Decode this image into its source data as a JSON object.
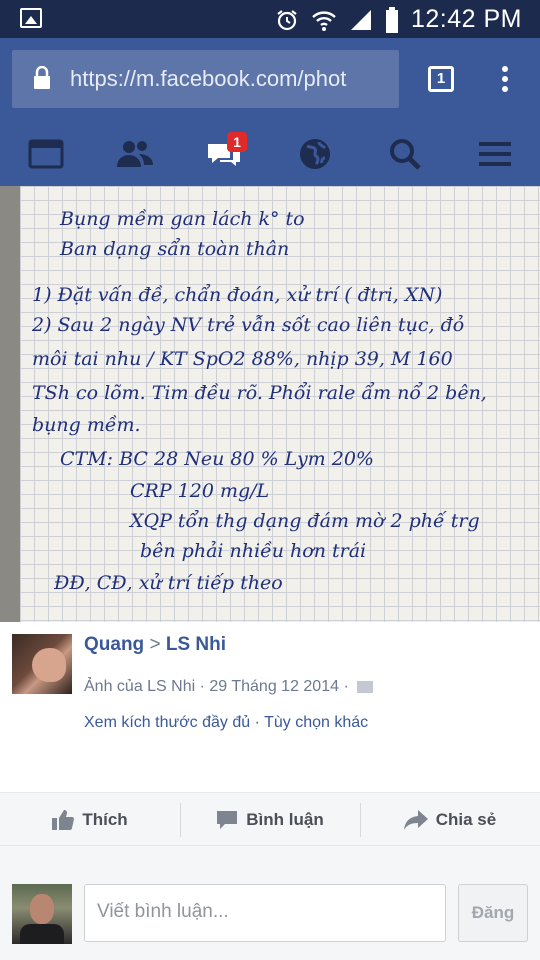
{
  "status_bar": {
    "time": "12:42 PM"
  },
  "browser": {
    "url": "https://m.facebook.com/phot",
    "tab_count": "1"
  },
  "fb_nav": {
    "messages_badge": "1"
  },
  "photo": {
    "note_lines": [
      "Bụng mềm gan lách k° to",
      "Ban dạng sẩn toàn thân",
      "1) Đặt vấn đề, chẩn đoán, xử trí ( đtri, XN)",
      "2) Sau 2 ngày NV trẻ vẫn sốt cao liên tục, đỏ",
      "môi tai nhu / KT   SpO2 88%, nhịp 39, M 160",
      "TSh co lõm. Tim đều rõ. Phổi rale ẩm nổ 2 bên,",
      "bụng mềm.",
      "CTM:  BC 28      Neu 80 %   Lym 20%",
      "CRP 120 mg/L",
      "XQP tổn thg dạng đám mờ 2 phế trg",
      "bên phải nhiều hơn trái",
      "ĐĐ, CĐ, xử trí tiếp theo"
    ]
  },
  "post": {
    "author": "Quang",
    "separator": ">",
    "target": "LS Nhi",
    "meta": "Ảnh của LS Nhi · 29 Tháng 12 2014 ·",
    "links": "Xem kích thước đầy đủ · Tùy chọn khác"
  },
  "actions": {
    "like": "Thích",
    "comment": "Bình luận",
    "share": "Chia sẻ"
  },
  "comment_box": {
    "placeholder": "Viết bình luận...",
    "post_button": "Đăng"
  },
  "colors": {
    "facebook_blue": "#3b5998",
    "status_bar": "#1b2a4d",
    "badge_red": "#e02a2a",
    "ink_blue": "#1f2f7a"
  }
}
